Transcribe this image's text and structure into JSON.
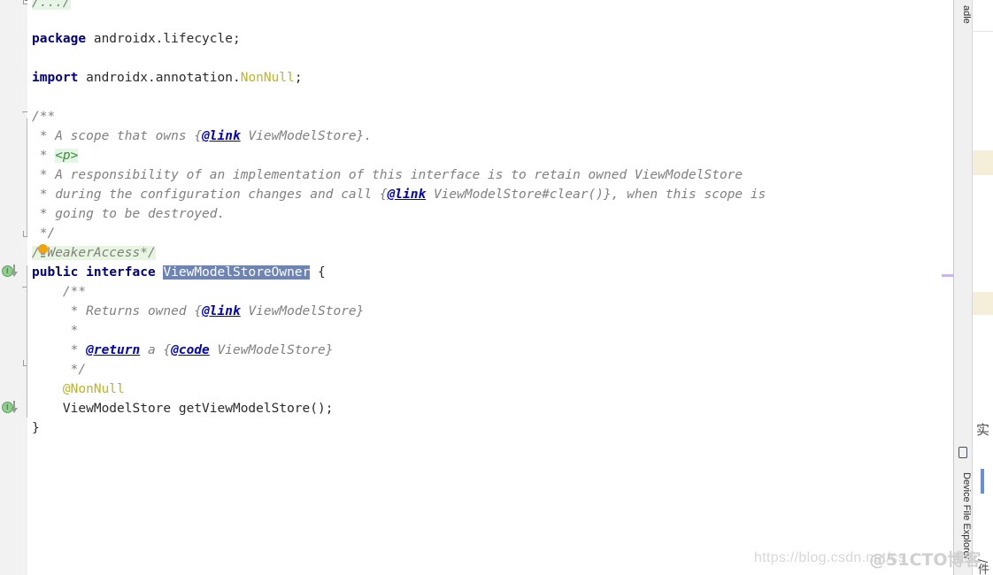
{
  "app": {
    "kind": "java-code-editor",
    "file_language": "Java"
  },
  "colors": {
    "keyword": "#000080",
    "annotation": "#bbb529",
    "comment": "#808080",
    "javadoc_tag": "#0000c0",
    "html_tag": "#3d8b3d",
    "selection": "#6d84b4",
    "caret_line": "#fdf6dd",
    "gutter_bg": "#f2f2f2",
    "implemented_marker": "#8fce8f",
    "warning_stripe": "#efe6c4",
    "bookmark_stripe": "#c9b6f0",
    "bulb": "#f0a30a"
  },
  "editor": {
    "folded_top_line": "/.../",
    "lines": [
      {
        "id": "fold",
        "segments": [
          {
            "text": "/.../",
            "style": "fold"
          }
        ]
      },
      {
        "id": "blank1",
        "segments": []
      },
      {
        "id": "package",
        "segments": [
          {
            "text": "package",
            "style": "kw"
          },
          {
            "text": " androidx.lifecycle;",
            "style": "plain"
          }
        ]
      },
      {
        "id": "blank2",
        "segments": []
      },
      {
        "id": "import",
        "segments": [
          {
            "text": "import",
            "style": "kw"
          },
          {
            "text": " androidx.annotation.",
            "style": "plain"
          },
          {
            "text": "NonNull",
            "style": "anno"
          },
          {
            "text": ";",
            "style": "plain"
          }
        ]
      },
      {
        "id": "blank3",
        "segments": []
      },
      {
        "id": "jd-open",
        "segments": [
          {
            "text": "/**",
            "style": "cmt"
          }
        ]
      },
      {
        "id": "jd-1",
        "segments": [
          {
            "text": " * A scope that owns {",
            "style": "cmt"
          },
          {
            "text": "@link",
            "style": "jdtag"
          },
          {
            "text": " ViewModelStore}.",
            "style": "cmt"
          }
        ]
      },
      {
        "id": "jd-2",
        "segments": [
          {
            "text": " * ",
            "style": "cmt"
          },
          {
            "text": "<p>",
            "style": "tag"
          }
        ]
      },
      {
        "id": "jd-3",
        "segments": [
          {
            "text": " * A responsibility of an implementation of this interface is to retain owned ViewModelStore",
            "style": "cmt"
          }
        ]
      },
      {
        "id": "jd-4",
        "segments": [
          {
            "text": " * during the configuration changes and call {",
            "style": "cmt"
          },
          {
            "text": "@link",
            "style": "jdtag"
          },
          {
            "text": " ViewModelStore#clear()}, when this scope is",
            "style": "cmt"
          }
        ]
      },
      {
        "id": "jd-5",
        "segments": [
          {
            "text": " * going to be destroyed.",
            "style": "cmt"
          }
        ]
      },
      {
        "id": "jd-close",
        "segments": [
          {
            "text": " */",
            "style": "cmt"
          }
        ]
      },
      {
        "id": "weaker",
        "segments": [
          {
            "text": "/*WeakerAccess*/",
            "style": "cmt-hl"
          }
        ]
      },
      {
        "id": "decl",
        "segments": [
          {
            "text": "public",
            "style": "kw"
          },
          {
            "text": " ",
            "style": "plain"
          },
          {
            "text": "interface",
            "style": "kw"
          },
          {
            "text": " ",
            "style": "plain"
          },
          {
            "text": "ViewModelStoreOwner",
            "style": "sel"
          },
          {
            "text": " {",
            "style": "plain"
          }
        ]
      },
      {
        "id": "ijd-open",
        "segments": [
          {
            "text": "    /**",
            "style": "cmt"
          }
        ]
      },
      {
        "id": "ijd-1",
        "segments": [
          {
            "text": "     * Returns owned {",
            "style": "cmt"
          },
          {
            "text": "@link",
            "style": "jdtag"
          },
          {
            "text": " ViewModelStore}",
            "style": "cmt"
          }
        ]
      },
      {
        "id": "ijd-2",
        "segments": [
          {
            "text": "     *",
            "style": "cmt"
          }
        ]
      },
      {
        "id": "ijd-3",
        "segments": [
          {
            "text": "     * ",
            "style": "cmt"
          },
          {
            "text": "@return",
            "style": "jdtag"
          },
          {
            "text": " a {",
            "style": "cmt"
          },
          {
            "text": "@code",
            "style": "jdtag"
          },
          {
            "text": " ViewModelStore}",
            "style": "cmt"
          }
        ]
      },
      {
        "id": "ijd-close",
        "segments": [
          {
            "text": "     */",
            "style": "cmt"
          }
        ]
      },
      {
        "id": "nonnull",
        "segments": [
          {
            "text": "    @NonNull",
            "style": "anno"
          }
        ]
      },
      {
        "id": "method",
        "segments": [
          {
            "text": "    ViewModelStore getViewModelStore();",
            "style": "plain"
          }
        ]
      },
      {
        "id": "close",
        "segments": [
          {
            "text": "}",
            "style": "plain"
          }
        ]
      }
    ],
    "selected_text": "ViewModelStoreOwner",
    "caret_line_id": "decl",
    "gutter_markers": [
      {
        "name": "implemented-marker",
        "line_id": "decl",
        "glyph": "I",
        "direction": "down"
      },
      {
        "name": "implemented-marker",
        "line_id": "method",
        "glyph": "I",
        "direction": "down"
      }
    ],
    "intention_bulb": {
      "name": "intention-bulb-icon",
      "line_id": "weaker"
    }
  },
  "right_toolbar": {
    "tabs": [
      {
        "id": "gradle",
        "label": "Gradle",
        "visible_label": "adle",
        "icon": "elephant-icon"
      },
      {
        "id": "device-file-explorer",
        "label": "Device File Explorer",
        "icon": "device-icon"
      }
    ]
  },
  "analysis_stripe": {
    "markers": [
      {
        "type": "warning",
        "color": "#efe6c4"
      },
      {
        "type": "warning",
        "color": "#efe6c4"
      },
      {
        "type": "bookmark",
        "color": "#c9b6f0"
      }
    ]
  },
  "watermarks": [
    {
      "id": "csdn",
      "text": "https://blog.csdn.net/cs"
    },
    {
      "id": "51cto",
      "text": "@51CTO博客"
    }
  ],
  "right_pane": {
    "cjk_snippet_1": "实",
    "cjk_snippet_2": "/件"
  }
}
